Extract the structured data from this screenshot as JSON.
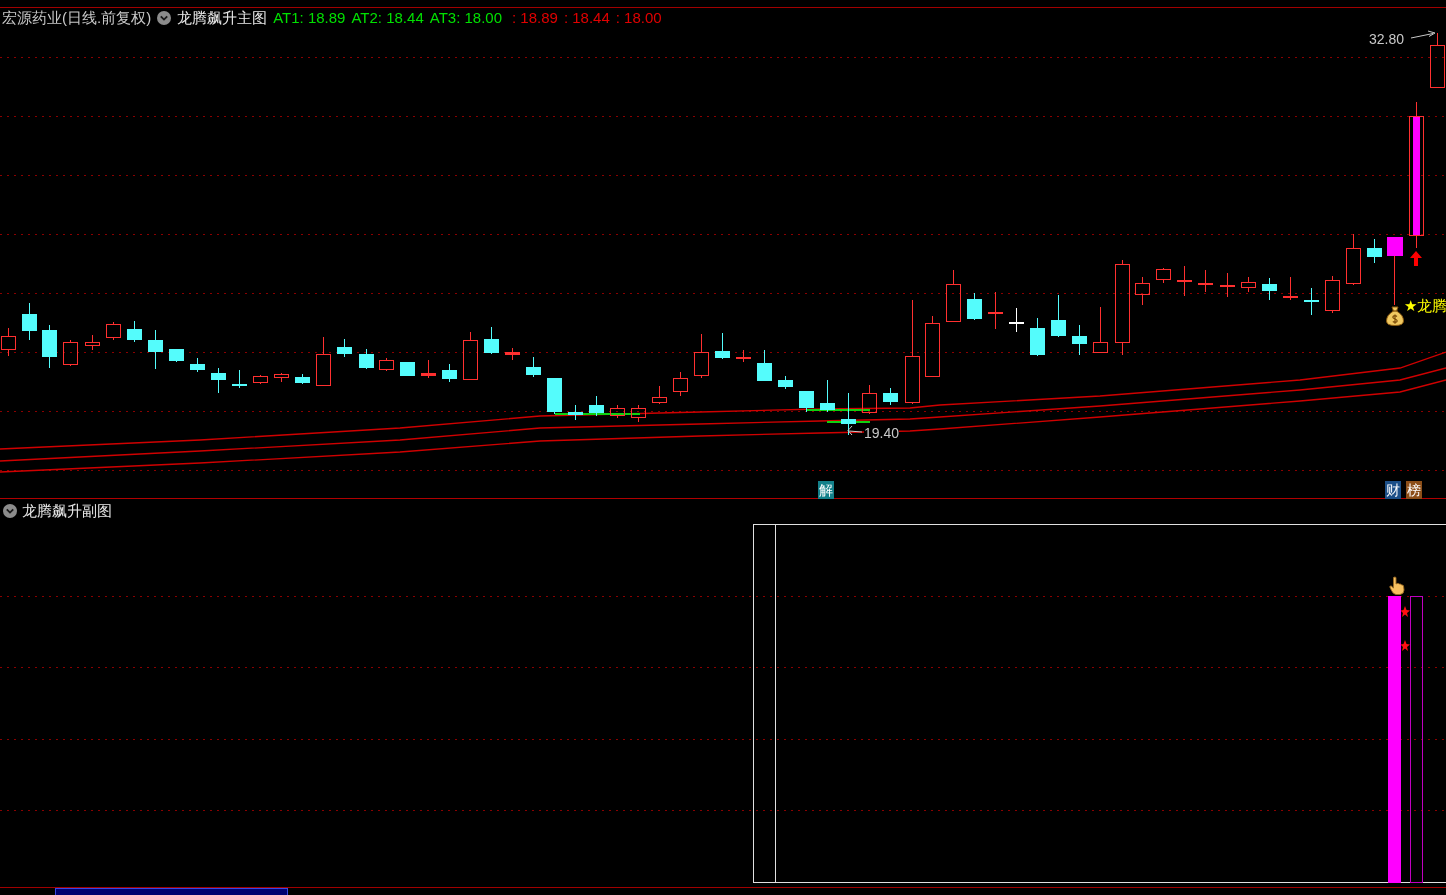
{
  "main_chart": {
    "security": "宏源药业(日线.前复权)",
    "indicator": "龙腾飙升主图",
    "values": [
      {
        "text": "AT1: 18.89",
        "color": "#00e000"
      },
      {
        "text": "AT2: 18.44",
        "color": "#00e000"
      },
      {
        "text": "AT3: 18.00",
        "color": "#00e000"
      },
      {
        "text": ": 18.89",
        "color": "#e00000"
      },
      {
        "text": ": 18.44",
        "color": "#e00000"
      },
      {
        "text": ": 18.00",
        "color": "#e00000"
      }
    ],
    "high_label": "32.80",
    "low_label": "19.40",
    "signal_label": "★龙腾",
    "badges": [
      {
        "text": "解",
        "color": "#13808a"
      },
      {
        "text": "财",
        "color": "#1c4f88"
      },
      {
        "text": "榜",
        "color": "#8c4e18"
      }
    ]
  },
  "sub_chart": {
    "indicator": "龙腾飙升副图"
  }
}
